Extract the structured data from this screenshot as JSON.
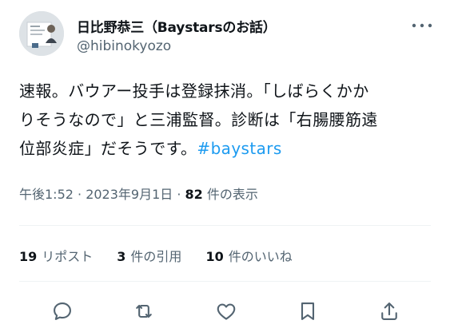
{
  "author": {
    "display_name": "日比野恭三（Baystarsのお話）",
    "handle": "@hibinokyozo"
  },
  "tweet": {
    "text_line1": "速報。バウアー投手は登録抹消。「しばらくかか",
    "text_line2": "りそうなので」と三浦監督。診断は「右腸腰筋遠",
    "text_line3_main": "位部炎症」だそうです。",
    "hashtag": "#baystars"
  },
  "meta": {
    "timestamp": "午後1:52 · 2023年9月1日 · ",
    "view_count": "82",
    "view_label": " 件の表示"
  },
  "stats": {
    "reposts_count": "19",
    "reposts_label": "リポスト",
    "quotes_count": "3",
    "quotes_label": "件の引用",
    "likes_count": "10",
    "likes_label": "件のいいね"
  },
  "icons": {
    "more": "more-icon",
    "reply": "reply-icon",
    "repost": "repost-icon",
    "like": "like-icon",
    "bookmark": "bookmark-icon",
    "share": "share-icon"
  },
  "colors": {
    "text": "#0f1419",
    "secondary": "#536471",
    "accent": "#1d9bf0",
    "divider": "#eff3f4"
  }
}
